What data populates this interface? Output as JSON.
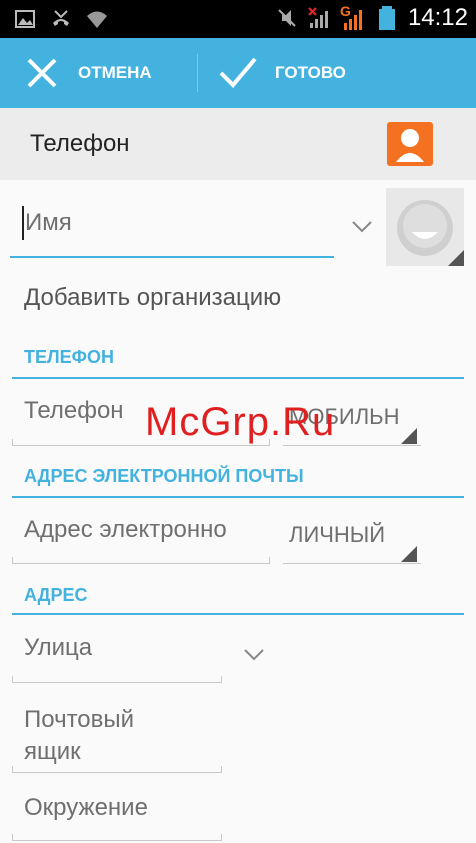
{
  "status_bar": {
    "time": "14:12",
    "network_label": "G",
    "icons": [
      "picture-icon",
      "missed-call-icon",
      "wifi-icon",
      "mute-icon",
      "no-signal-icon",
      "signal-icon",
      "battery-icon"
    ]
  },
  "action_bar": {
    "cancel_label": "ОТМЕНА",
    "done_label": "ГОТОВО",
    "icons": [
      "close-icon",
      "check-icon"
    ]
  },
  "account": {
    "label": "Телефон",
    "icon": "contact-account-icon"
  },
  "name_field": {
    "placeholder": "Имя"
  },
  "add_org_label": "Добавить организацию",
  "phone_section": {
    "title": "ТЕЛЕФОН",
    "placeholder": "Телефон",
    "type_value": "МОБИЛЬНЫ"
  },
  "email_section": {
    "title": "АДРЕС ЭЛЕКТРОННОЙ ПОЧТЫ",
    "placeholder": "Адрес электронно",
    "type_value": "ЛИЧНЫЙ"
  },
  "address_section": {
    "title": "АДРЕС",
    "street_placeholder": "Улица",
    "pobox_line1": "Почтовый",
    "pobox_line2": "ящик",
    "neighborhood_placeholder": "Окружение"
  },
  "watermark": "McGrp.Ru",
  "colors": {
    "accent": "#43b2df",
    "account_icon": "#f37121",
    "status_bar": "#000000"
  }
}
